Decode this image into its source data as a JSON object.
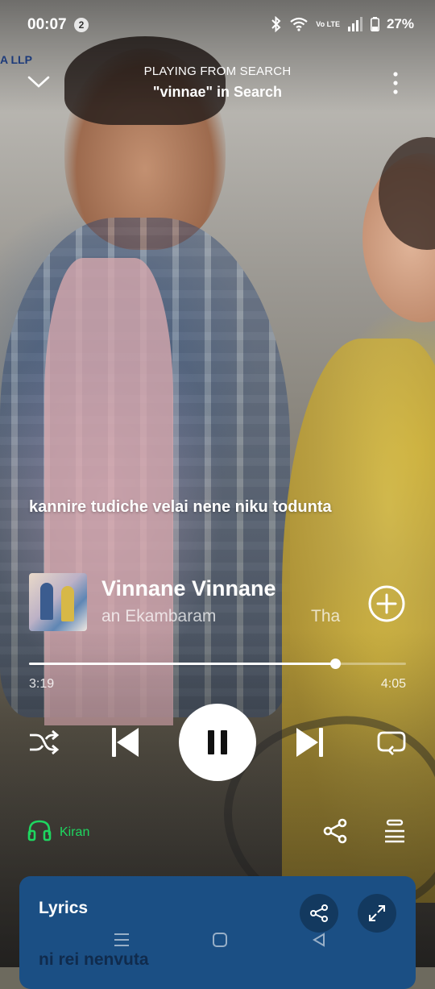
{
  "status_bar": {
    "time": "00:07",
    "notification_count": "2",
    "network_label": "Vo LTE",
    "battery": "27%"
  },
  "header": {
    "context_label": "PLAYING FROM SEARCH",
    "context_name": "\"vinnae\" in Search"
  },
  "background": {
    "logo_text": "A LLP"
  },
  "current_lyric": "kannire tudiche velai nene niku todunta",
  "track": {
    "title": "Vinnane Vinnane",
    "artist_scroll": "an Ekambaram",
    "artist_scroll_next": "Tha"
  },
  "playback": {
    "elapsed": "3:19",
    "duration": "4:05",
    "progress_fraction": 0.813,
    "state": "playing"
  },
  "device": {
    "name": "Kiran",
    "icon": "headphones-icon",
    "color": "#1ed760"
  },
  "lyrics_card": {
    "title": "Lyrics",
    "preview_line": "ni rei nenvuta",
    "background": "#1b4f84"
  }
}
